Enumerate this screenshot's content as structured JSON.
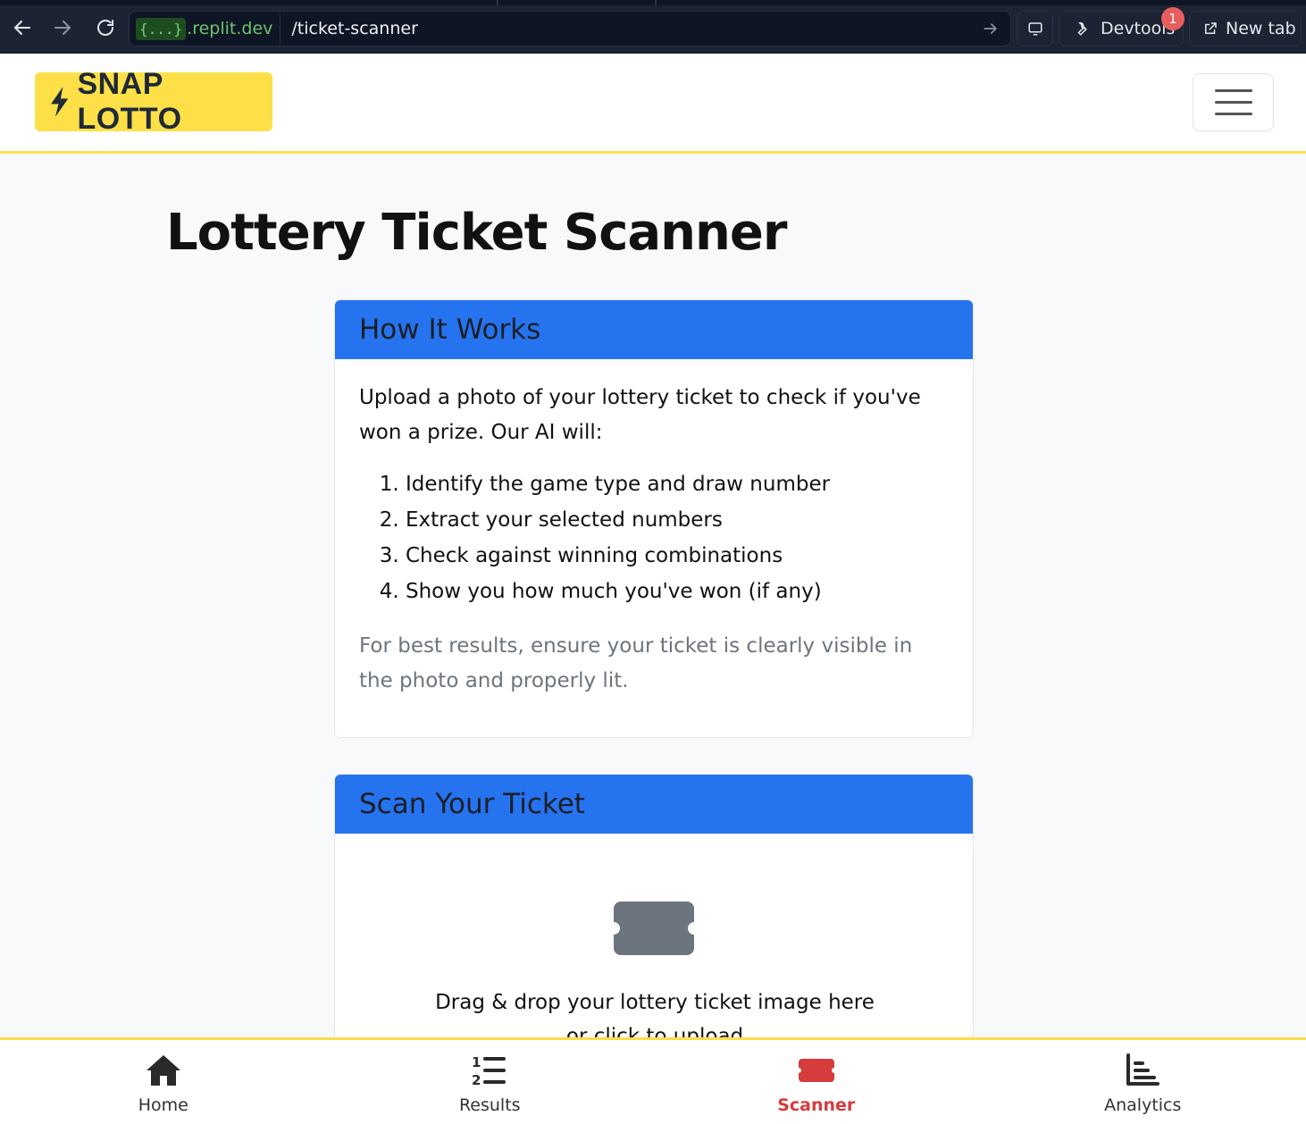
{
  "browser": {
    "url_braces": "{...}",
    "url_domain": ".replit.dev",
    "url_path": "/ticket-scanner",
    "devtools_label": "Devtools",
    "devtools_badge": "1",
    "new_tab_label": "New tab"
  },
  "navbar": {
    "brand": "SNAP LOTTO",
    "brand_icon": "bolt-icon",
    "menu_icon": "hamburger-icon"
  },
  "page": {
    "title": "Lottery Ticket Scanner"
  },
  "how_it_works": {
    "header": "How It Works",
    "intro": "Upload a photo of your lottery ticket to check if you've won a prize. Our AI will:",
    "steps": [
      "Identify the game type and draw number",
      "Extract your selected numbers",
      "Check against winning combinations",
      "Show you how much you've won (if any)"
    ],
    "tip": "For best results, ensure your ticket is clearly visible in the photo and properly lit."
  },
  "scan": {
    "header": "Scan Your Ticket",
    "icon": "ticket-icon",
    "drag_text": "Drag & drop your lottery ticket image here",
    "or_text": "or click to upload"
  },
  "bottom_nav": {
    "items": [
      {
        "label": "Home",
        "icon": "home-icon"
      },
      {
        "label": "Results",
        "icon": "list-ol-icon"
      },
      {
        "label": "Scanner",
        "icon": "ticket-icon",
        "active": true
      },
      {
        "label": "Analytics",
        "icon": "chart-icon"
      }
    ],
    "active_color": "#d63c3c"
  },
  "colors": {
    "accent_blue": "#2673f0",
    "brand_yellow": "#fde047",
    "border_yellow": "#fdde46"
  }
}
